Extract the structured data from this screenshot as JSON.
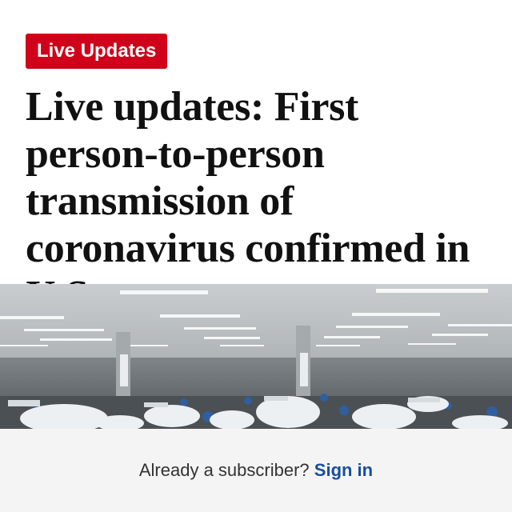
{
  "badge": {
    "label": "Live Updates"
  },
  "article": {
    "headline": "Live updates: First person-to-person transmission of coronavirus confirmed in U.S."
  },
  "footer": {
    "prompt": "Already a subscriber?",
    "signin_label": "Sign in"
  },
  "colors": {
    "badge_bg": "#d0021b",
    "link": "#1a4e9a",
    "footer_bg": "#f4f4f4"
  }
}
